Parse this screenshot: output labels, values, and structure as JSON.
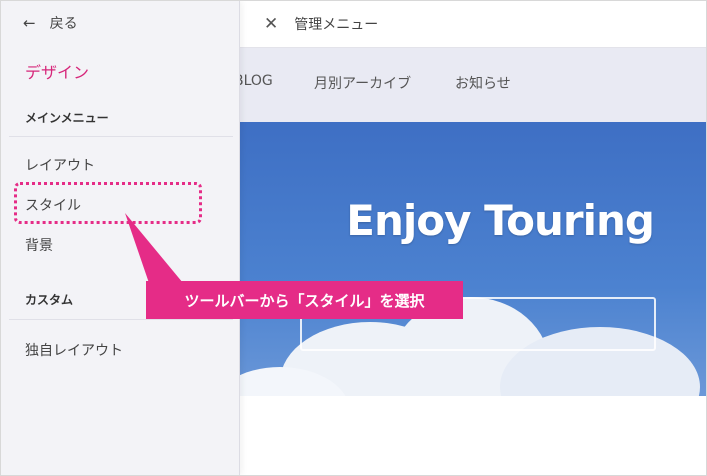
{
  "sidebar": {
    "back_label": "戻る",
    "section_title": "デザイン",
    "groups": [
      {
        "label": "メインメニュー",
        "items": [
          "レイアウト",
          "スタイル",
          "背景"
        ]
      },
      {
        "label": "カスタム",
        "items": [
          "独自レイアウト"
        ]
      }
    ]
  },
  "topbar": {
    "title": "管理メニュー"
  },
  "site_nav": {
    "items": [
      "BLOG",
      "月別アーカイブ",
      "お知らせ"
    ]
  },
  "hero": {
    "title": "Enjoy Touring"
  },
  "annotation": {
    "text": "ツールバーから「スタイル」を選択",
    "color": "#e52c87"
  },
  "colors": {
    "accent": "#d6267a",
    "hero_sky": "#3e6fc4"
  },
  "icons": {
    "back": "arrow-left-icon",
    "close": "close-icon"
  }
}
